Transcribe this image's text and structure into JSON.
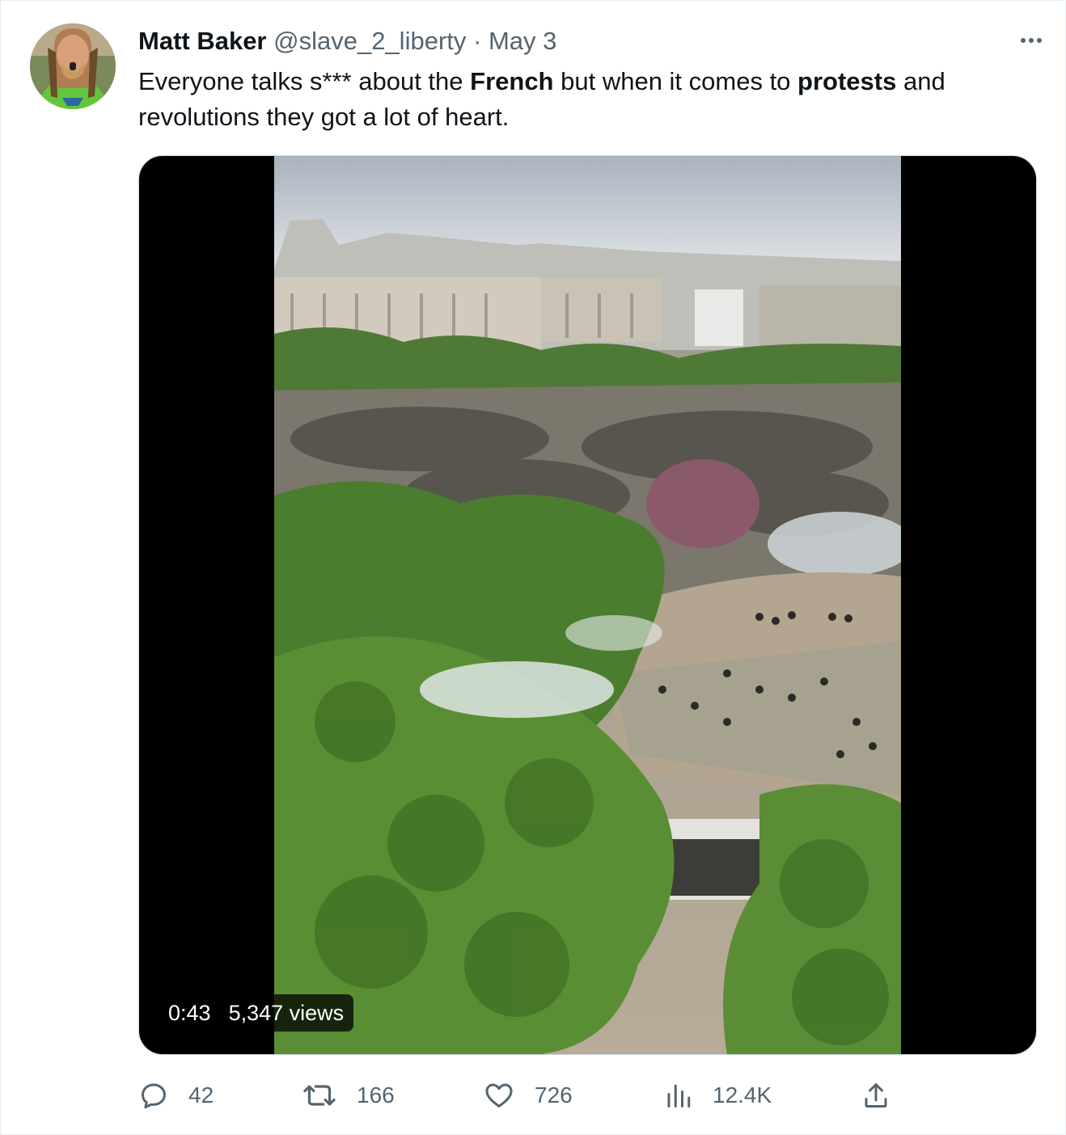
{
  "tweet": {
    "author_name": "Matt Baker",
    "author_handle": "@slave_2_liberty",
    "separator": "·",
    "date": "May 3",
    "text_parts": [
      "Everyone talks s*** about the ",
      "French",
      " but when it comes to ",
      "protests",
      " and revolutions they got a lot of heart."
    ]
  },
  "video": {
    "duration": "0:43",
    "views": "5,347 views"
  },
  "actions": {
    "replies": "42",
    "retweets": "166",
    "likes": "726",
    "views": "12.4K"
  },
  "icons": {
    "more": "more-horizontal-icon",
    "reply": "reply-icon",
    "retweet": "retweet-icon",
    "like": "heart-icon",
    "analytics": "analytics-icon",
    "share": "share-icon"
  },
  "colors": {
    "text_primary": "#0f1419",
    "text_secondary": "#536471",
    "border": "#cfd9de"
  }
}
